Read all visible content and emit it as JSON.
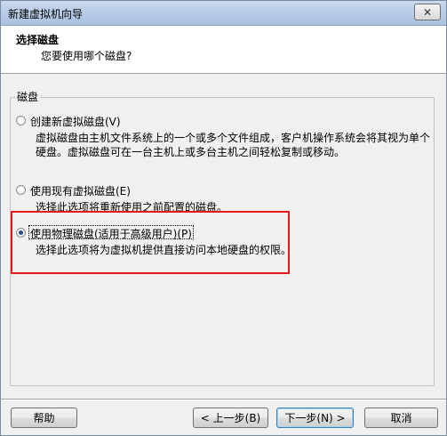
{
  "window": {
    "title": "新建虚拟机向导"
  },
  "header": {
    "title": "选择磁盘",
    "subtitle": "您要使用哪个磁盘?"
  },
  "group": {
    "label": "磁盘"
  },
  "options": [
    {
      "label": "创建新虚拟磁盘(V)",
      "description": "虚拟磁盘由主机文件系统上的一个或多个文件组成，客户机操作系统会将其视为单个硬盘。虚拟磁盘可在一台主机上或多台主机之间轻松复制或移动。",
      "checked": false
    },
    {
      "label": "使用现有虚拟磁盘(E)",
      "description": "选择此选项将重新使用之前配置的磁盘。",
      "checked": false
    },
    {
      "label": "使用物理磁盘(适用于高级用户)(P)",
      "description": "选择此选项将为虚拟机提供直接访问本地硬盘的权限。",
      "checked": true
    }
  ],
  "buttons": {
    "help": "帮助",
    "back": "< 上一步(B)",
    "next": "下一步(N) >",
    "cancel": "取消"
  },
  "colors": {
    "highlight": "#e5191a",
    "radio_dot": "#2a4d8f"
  }
}
